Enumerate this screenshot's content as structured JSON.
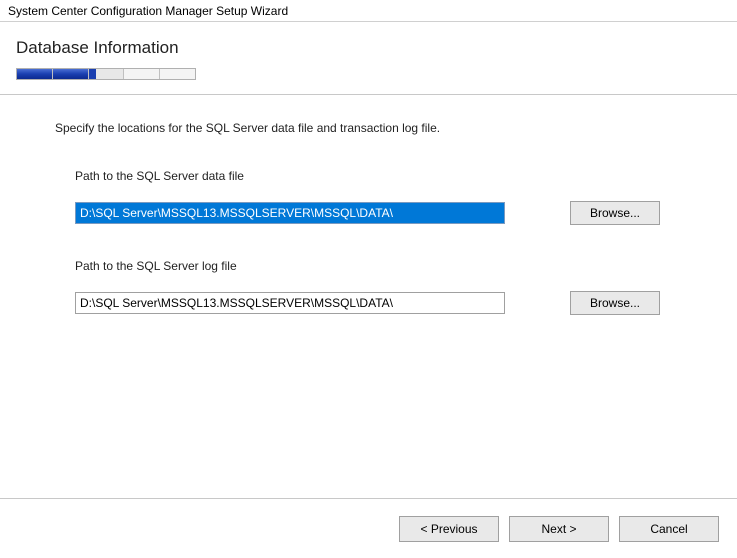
{
  "window": {
    "title": "System Center Configuration Manager Setup Wizard"
  },
  "header": {
    "title": "Database Information"
  },
  "instruction": "Specify the locations for the SQL Server data file and transaction log file.",
  "fields": {
    "dataFile": {
      "label": "Path to the SQL Server data file",
      "value": "D:\\SQL Server\\MSSQL13.MSSQLSERVER\\MSSQL\\DATA\\",
      "browse": "Browse..."
    },
    "logFile": {
      "label": "Path to the SQL Server log file",
      "value": "D:\\SQL Server\\MSSQL13.MSSQLSERVER\\MSSQL\\DATA\\",
      "browse": "Browse..."
    }
  },
  "footer": {
    "previous": "< Previous",
    "next": "Next >",
    "cancel": "Cancel"
  }
}
